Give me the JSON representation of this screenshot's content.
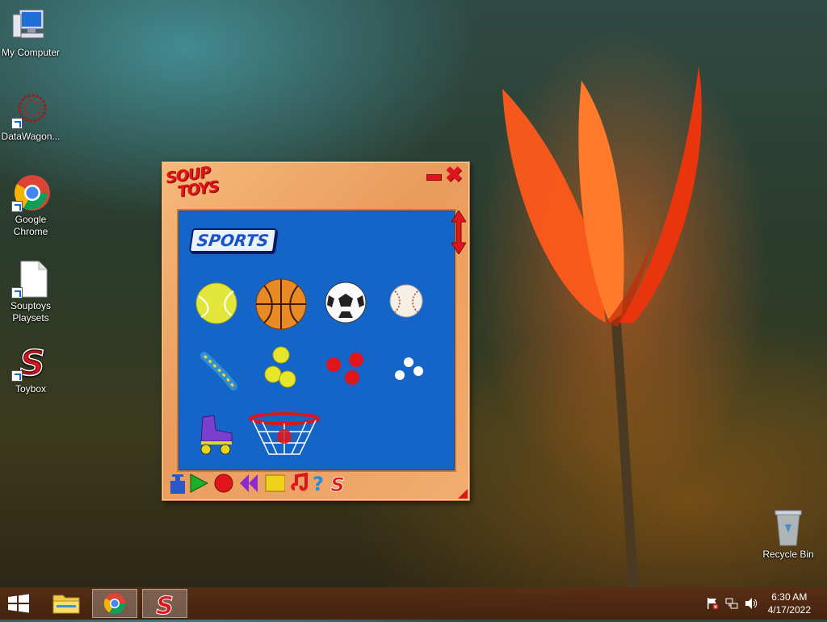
{
  "desktop": {
    "icons": [
      {
        "label": "My Computer"
      },
      {
        "label": "DataWagon..."
      },
      {
        "label": "Google Chrome"
      },
      {
        "label": "Souptoys Playsets"
      },
      {
        "label": "Toybox"
      },
      {
        "label": "Recycle Bin"
      }
    ]
  },
  "souptoys": {
    "logo_line1": "SOUP",
    "logo_line2": "TOYS",
    "category": "SPORTS",
    "toys": [
      "tennis-ball",
      "basketball",
      "soccer-ball",
      "baseball",
      "skipping-rope",
      "yellow-balls",
      "red-balls",
      "white-balls",
      "roller-skate",
      "basketball-hoop"
    ],
    "toolbar_icons": [
      "pump",
      "play",
      "record",
      "rewind",
      "stop",
      "music",
      "help",
      "souptoys"
    ]
  },
  "taskbar": {
    "time": "6:30 AM",
    "date": "4/17/2022",
    "tray_icons": [
      "action-center-flag",
      "network",
      "volume"
    ]
  },
  "colors": {
    "panel_blue": "#1565c8",
    "frame_orange": "#f2ad70",
    "brand_red": "#e0151c"
  }
}
